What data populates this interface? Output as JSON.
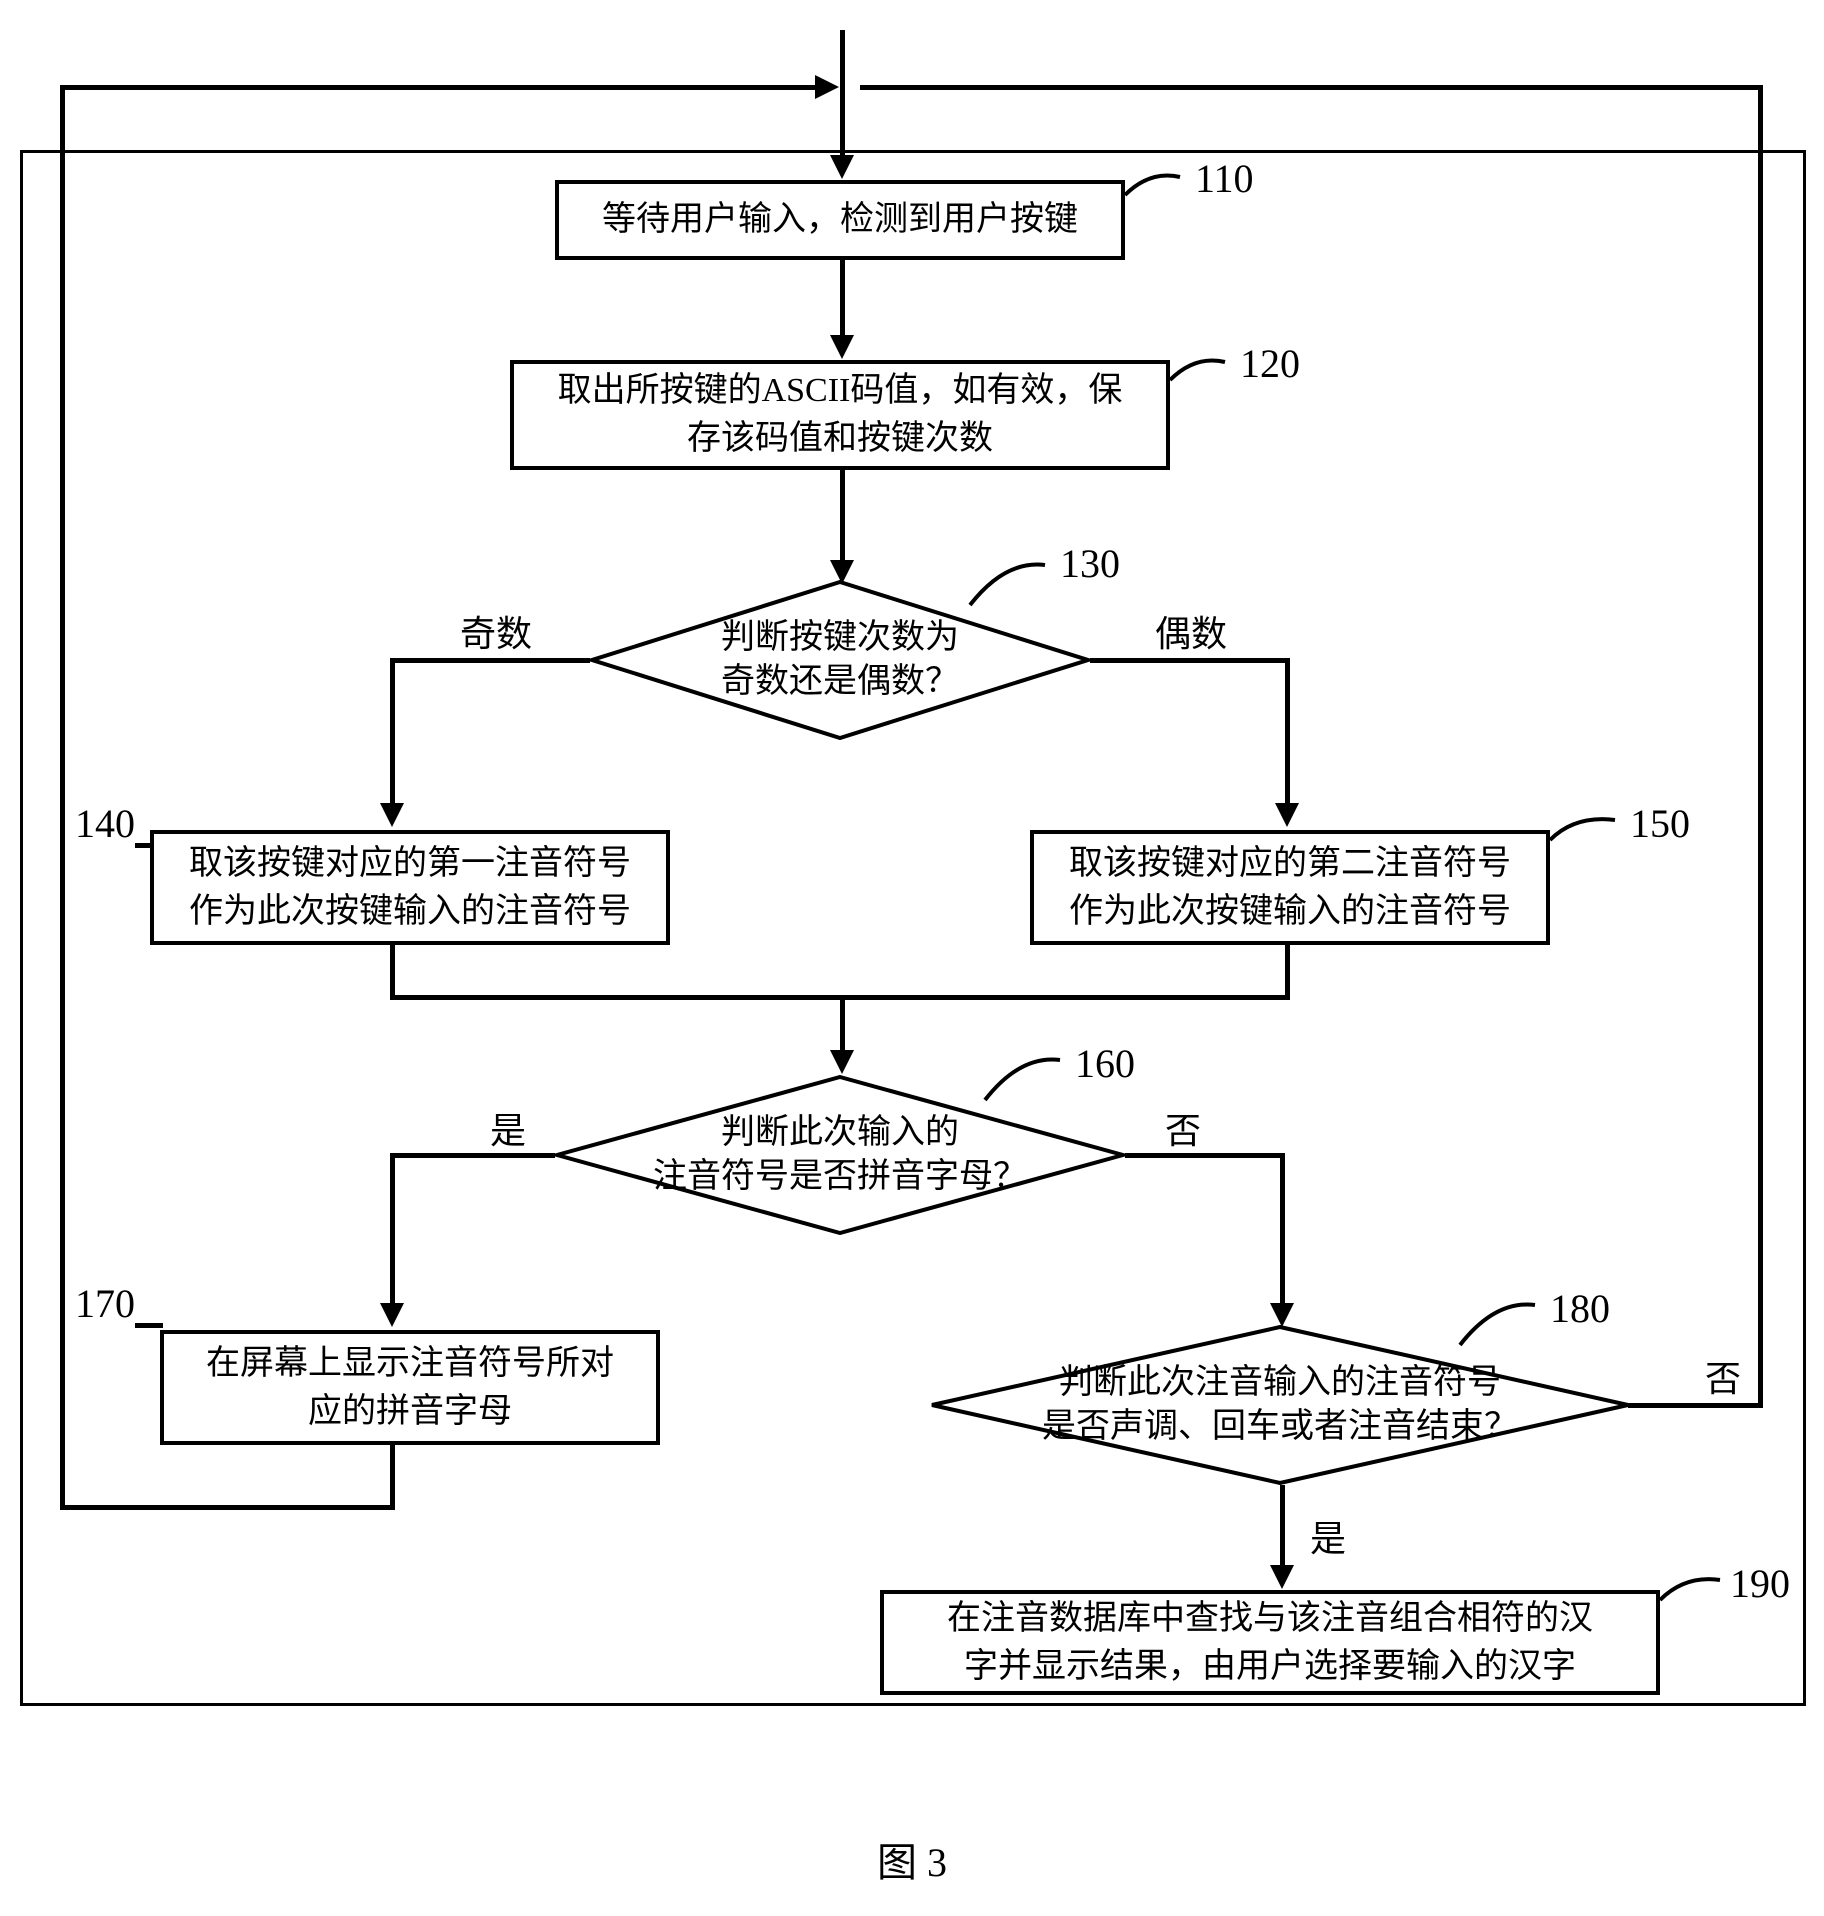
{
  "nodes": {
    "n110": "等待用户输入，检测到用户按键",
    "n120": "取出所按键的ASCII码值，如有效，保\n存该码值和按键次数",
    "n130": "判断按键次数为\n奇数还是偶数？",
    "n140": "取该按键对应的第一注音符号\n作为此次按键输入的注音符号",
    "n150": "取该按键对应的第二注音符号\n作为此次按键输入的注音符号",
    "n160": "判断此次输入的\n注音符号是否拼音字母？",
    "n170": "在屏幕上显示注音符号所对\n应的拼音字母",
    "n180": "判断此次注音输入的注音符号\n是否声调、回车或者注音结束？",
    "n190": "在注音数据库中查找与该注音组合相符的汉\n字并显示结果，由用户选择要输入的汉字"
  },
  "refs": {
    "r110": "110",
    "r120": "120",
    "r130": "130",
    "r140": "140",
    "r150": "150",
    "r160": "160",
    "r170": "170",
    "r180": "180",
    "r190": "190"
  },
  "edge_labels": {
    "odd": "奇数",
    "even": "偶数",
    "yes160": "是",
    "no160": "否",
    "yes180": "是",
    "no180": "否"
  },
  "caption": "图 3"
}
